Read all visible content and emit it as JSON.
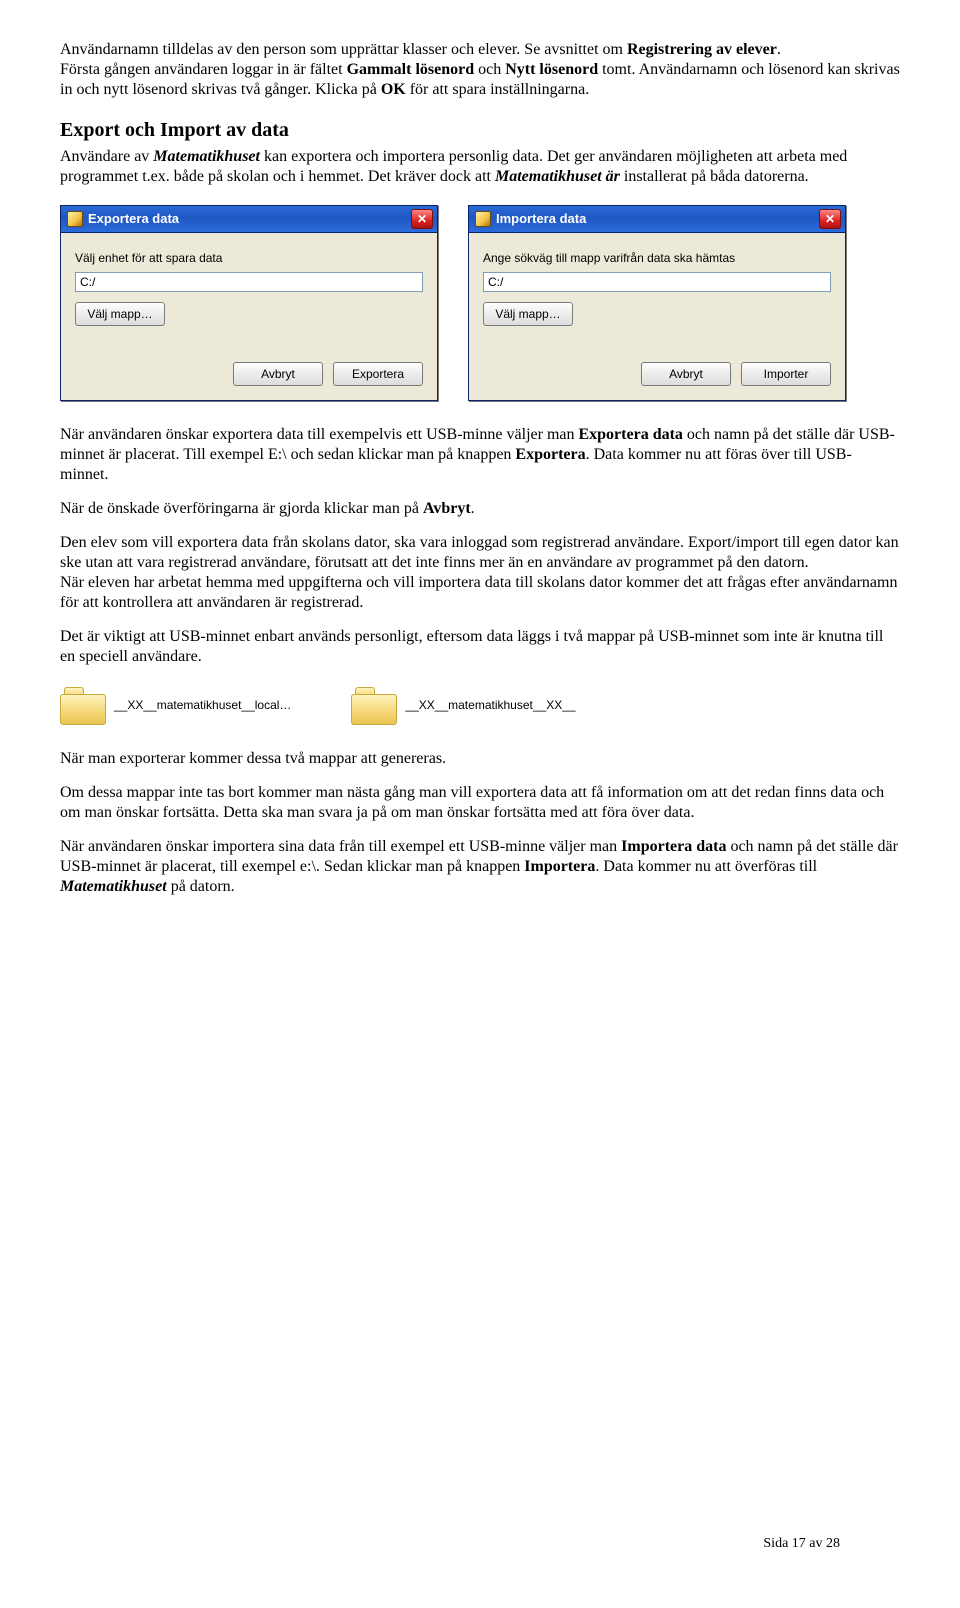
{
  "para1": {
    "t1": "Användarnamn tilldelas av den person som upprättar klasser och elever. Se avsnittet om ",
    "b1": "Registrering av elever",
    "t2": ".",
    "t3": "Första gången användaren loggar in är fältet ",
    "b2": "Gammalt lösenord",
    "t4": " och ",
    "b3": "Nytt lösenord",
    "t5": " tomt. Användarnamn och lösenord kan skrivas in och nytt lösenord skrivas två gånger. Klicka på ",
    "b4": "OK",
    "t6": " för att spara inställningarna."
  },
  "section_title": "Export och Import av data",
  "para2": {
    "t1": "Användare av ",
    "i1": "Matematikhuset",
    "t2": " kan exportera och importera personlig data. Det ger användaren möjligheten att arbeta med programmet t.ex. både på skolan och i hemmet. Det kräver dock att ",
    "i2": "Matematikhuset är",
    "t3": " installerat på båda datorerna."
  },
  "dialog_export": {
    "title": "Exportera data",
    "label": "Välj enhet för att spara data",
    "path": "C:/",
    "browse": "Välj mapp…",
    "cancel": "Avbryt",
    "action": "Exportera"
  },
  "dialog_import": {
    "title": "Importera data",
    "label": "Ange sökväg till mapp varifrån data ska hämtas",
    "path": "C:/",
    "browse": "Välj mapp…",
    "cancel": "Avbryt",
    "action": "Importer"
  },
  "para3": {
    "t1": "När användaren önskar exportera data till exempelvis ett USB-minne väljer man ",
    "b1": "Exportera data",
    "t2": " och namn på det ställe där USB-minnet är placerat. Till exempel E:\\ och sedan klickar man på knappen ",
    "b2": "Exportera",
    "t3": ". Data kommer nu att föras över till USB-minnet."
  },
  "para4": {
    "t1": "När de önskade överföringarna är gjorda klickar man på ",
    "b1": "Avbryt",
    "t2": "."
  },
  "para5": {
    "t1": "Den elev som vill exportera data från skolans dator, ska vara inloggad som registrerad användare. Export/import till egen dator kan ske utan att vara registrerad användare, förutsatt att det inte finns mer än en användare av programmet på den datorn.",
    "t2": "När eleven har arbetat hemma med uppgifterna och vill importera data till skolans dator kommer det att frågas efter användarnamn för att kontrollera att användaren är registrerad."
  },
  "para6": "Det är viktigt att USB-minnet enbart används personligt, eftersom data läggs i två mappar på USB-minnet som inte är knutna till en speciell användare.",
  "folders": {
    "name1": "__XX__matematikhuset__local…",
    "name2": "__XX__matematikhuset__XX__"
  },
  "para7": "När man exporterar kommer dessa två mappar att genereras.",
  "para8": "Om dessa mappar inte tas bort kommer man nästa gång man vill exportera data att få information om att det redan finns data och om man önskar fortsätta. Detta ska man svara ja på om man önskar fortsätta med att föra över data.",
  "para9": {
    "t1": "När användaren önskar importera sina data från till exempel ett USB-minne väljer man ",
    "b1": "Importera data",
    "t2": " och namn på det ställe där USB-minnet är placerat, till exempel e:\\. Sedan klickar man på knappen ",
    "b2": "Importera",
    "t3": ". Data kommer nu att överföras till ",
    "i1": "Matematikhuset",
    "t4": " på datorn."
  },
  "footer": "Sida 17 av 28"
}
